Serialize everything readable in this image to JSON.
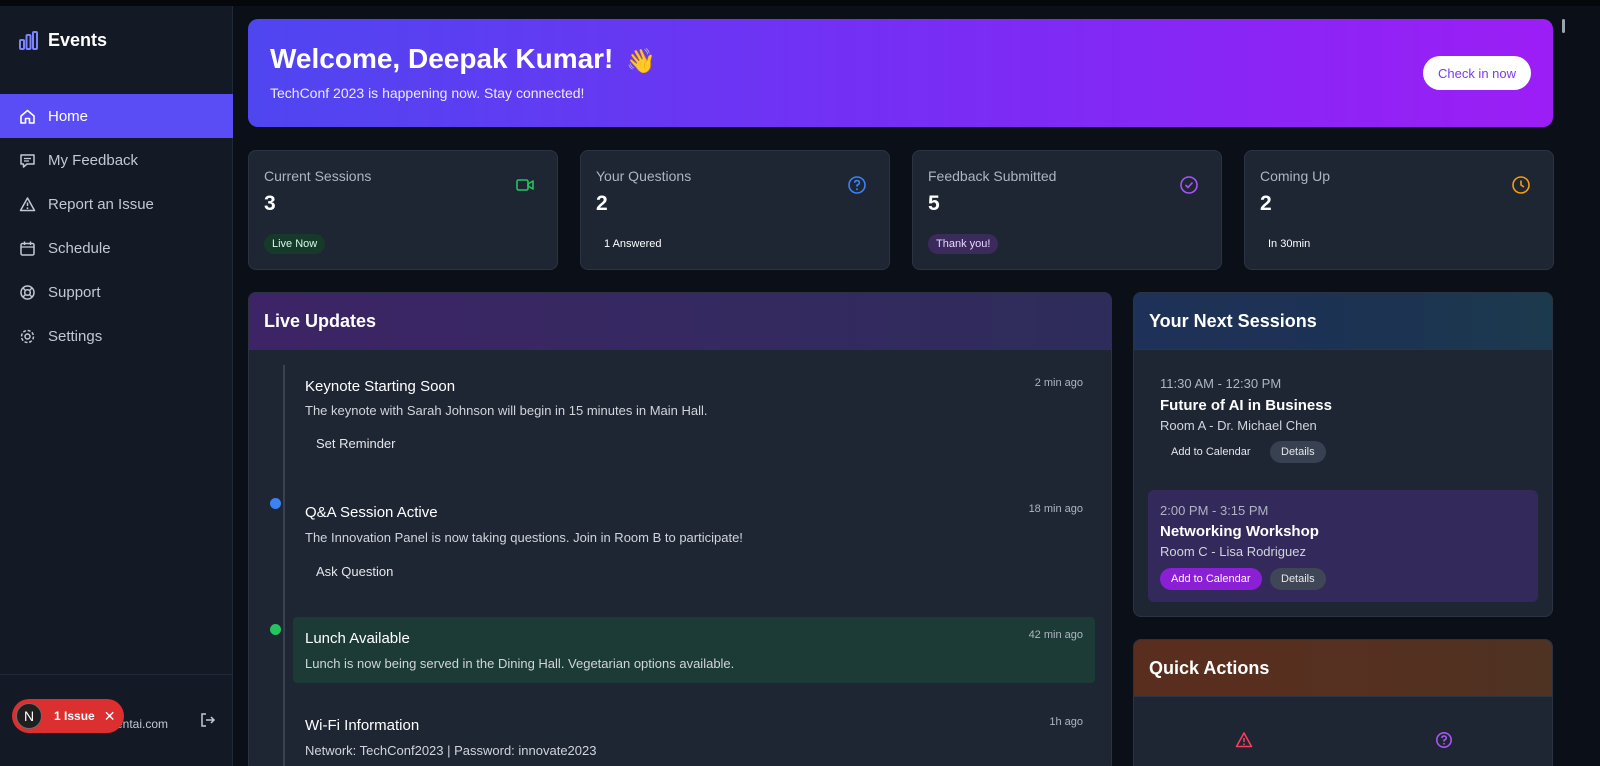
{
  "sidebar": {
    "brand": "Events",
    "nav": [
      {
        "label": "Home",
        "icon": "home-icon",
        "active": true
      },
      {
        "label": "My Feedback",
        "icon": "message-icon"
      },
      {
        "label": "Report an Issue",
        "icon": "warning-icon"
      },
      {
        "label": "Schedule",
        "icon": "calendar-icon"
      },
      {
        "label": "Support",
        "icon": "lifebuoy-icon"
      },
      {
        "label": "Settings",
        "icon": "gear-icon"
      }
    ],
    "user_email_partial": "entai.com",
    "issue_badge": {
      "letter": "N",
      "label": "1 Issue",
      "close": "✕"
    }
  },
  "hero": {
    "title": "Welcome, Deepak Kumar!",
    "wave": "👋",
    "subtitle": "TechConf 2023 is happening now. Stay connected!",
    "checkin_label": "Check in now"
  },
  "stats": [
    {
      "label": "Current Sessions",
      "value": "3",
      "badge": "Live Now",
      "icon": "video-icon",
      "accent": "#22c55e",
      "badge_bg": "#163a2a"
    },
    {
      "label": "Your Questions",
      "value": "2",
      "badge": "1 Answered",
      "icon": "question-icon",
      "accent": "#3b82f6",
      "badge_bg": "#1e2533"
    },
    {
      "label": "Feedback Submitted",
      "value": "5",
      "badge": "Thank you!",
      "icon": "check-circle-icon",
      "accent": "#a855f7",
      "badge_bg": "#3b2a5c"
    },
    {
      "label": "Coming Up",
      "value": "2",
      "badge": "In 30min",
      "icon": "clock-icon",
      "accent": "#f59e0b",
      "badge_bg": "#1e2533"
    }
  ],
  "live_updates": {
    "title": "Live Updates",
    "items": [
      {
        "title": "Keynote Starting Soon",
        "time": "2 min ago",
        "desc": "The keynote with Sarah Johnson will begin in 15 minutes in Main Hall.",
        "action": "Set Reminder"
      },
      {
        "title": "Q&A Session Active",
        "time": "18 min ago",
        "desc": "The Innovation Panel is now taking questions. Join in Room B to participate!",
        "action": "Ask Question"
      },
      {
        "title": "Lunch Available",
        "time": "42 min ago",
        "desc": "Lunch is now being served in the Dining Hall. Vegetarian options available."
      },
      {
        "title": "Wi-Fi Information",
        "time": "1h ago",
        "desc": "Network: TechConf2023 | Password: innovate2023"
      }
    ]
  },
  "next_sessions": {
    "title": "Your Next Sessions",
    "items": [
      {
        "time": "11:30 AM - 12:30 PM",
        "title": "Future of AI in Business",
        "room": "Room A - Dr. Michael Chen",
        "add_label": "Add to Calendar",
        "details_label": "Details"
      },
      {
        "time": "2:00 PM - 3:15 PM",
        "title": "Networking Workshop",
        "room": "Room C - Lisa Rodriguez",
        "add_label": "Add to Calendar",
        "details_label": "Details"
      }
    ]
  },
  "quick_actions": {
    "title": "Quick Actions",
    "icons": [
      "warning-icon",
      "question-icon"
    ]
  },
  "colors": {
    "accent": "#5b4df5",
    "brand_icon": "#7c83ff",
    "live_dot": "#22c55e",
    "qa_dot": "#3b82f6"
  }
}
